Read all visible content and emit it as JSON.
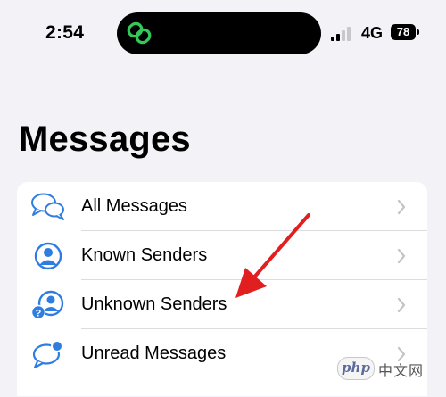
{
  "status_bar": {
    "time": "2:54",
    "network": "4G",
    "battery": "78"
  },
  "page_title": "Messages",
  "filters": [
    {
      "label": "All Messages",
      "icon": "chat-bubbles-icon"
    },
    {
      "label": "Known Senders",
      "icon": "person-circle-icon"
    },
    {
      "label": "Unknown Senders",
      "icon": "person-question-icon"
    },
    {
      "label": "Unread Messages",
      "icon": "bubble-dot-icon"
    }
  ],
  "colors": {
    "accent": "#2f7de1",
    "annotation_arrow": "#e11f1f",
    "background": "#f2f2f7",
    "link_icon": "#34c759"
  },
  "watermark": {
    "badge": "php",
    "text": "中文网"
  }
}
